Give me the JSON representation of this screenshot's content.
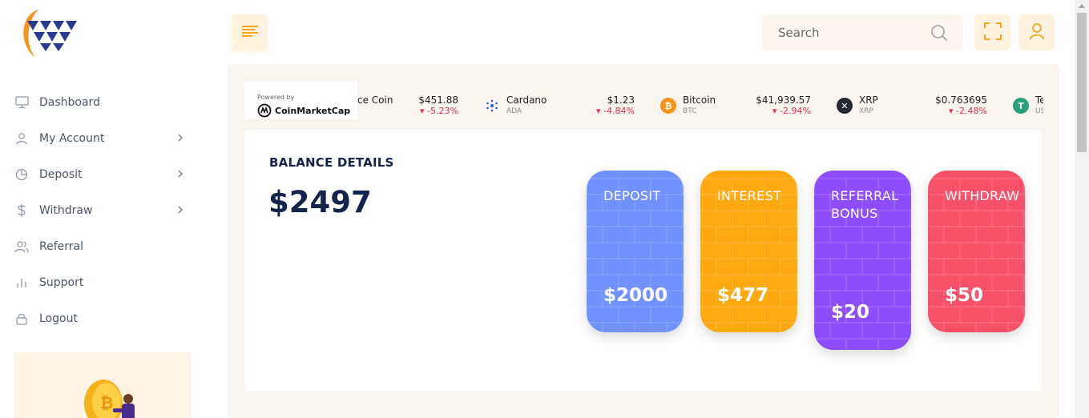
{
  "sidebar": {
    "items": [
      {
        "label": "Dashboard",
        "icon": "monitor-icon",
        "has_submenu": false
      },
      {
        "label": "My Account",
        "icon": "user-icon",
        "has_submenu": true
      },
      {
        "label": "Deposit",
        "icon": "pie-chart-icon",
        "has_submenu": true
      },
      {
        "label": "Withdraw",
        "icon": "dollar-icon",
        "has_submenu": true
      },
      {
        "label": "Referral",
        "icon": "users-icon",
        "has_submenu": false
      },
      {
        "label": "Support",
        "icon": "bar-chart-icon",
        "has_submenu": false
      },
      {
        "label": "Logout",
        "icon": "lock-icon",
        "has_submenu": false
      }
    ]
  },
  "header": {
    "search_placeholder": "Search"
  },
  "ticker": {
    "powered_by": "Powered by",
    "provider": "CoinMarketCap",
    "coins": [
      {
        "name": "ce Coin",
        "symbol": "",
        "price": "$451.88",
        "change": "-5.23%"
      },
      {
        "name": "Cardano",
        "symbol": "ADA",
        "price": "$1.23",
        "change": "-4.84%"
      },
      {
        "name": "Bitcoin",
        "symbol": "BTC",
        "price": "$41,939.57",
        "change": "-2.94%"
      },
      {
        "name": "XRP",
        "symbol": "XRP",
        "price": "$0.763695",
        "change": "-2.48%"
      },
      {
        "name": "Te",
        "symbol": "US",
        "price": "",
        "change": ""
      }
    ]
  },
  "balance": {
    "title": "BALANCE DETAILS",
    "amount": "$2497",
    "tiles": [
      {
        "label": "DEPOSIT",
        "value": "$2000",
        "color": "#6f92ff"
      },
      {
        "label": "INTEREST",
        "value": "$477",
        "color": "#ffa912"
      },
      {
        "label": "REFERRAL BONUS",
        "value": "$20",
        "color": "#8d4dfa"
      },
      {
        "label": "WITHDRAW",
        "value": "$50",
        "color": "#f7516a"
      }
    ]
  },
  "colors": {
    "accent": "#f5a623",
    "navy": "#15244a"
  }
}
